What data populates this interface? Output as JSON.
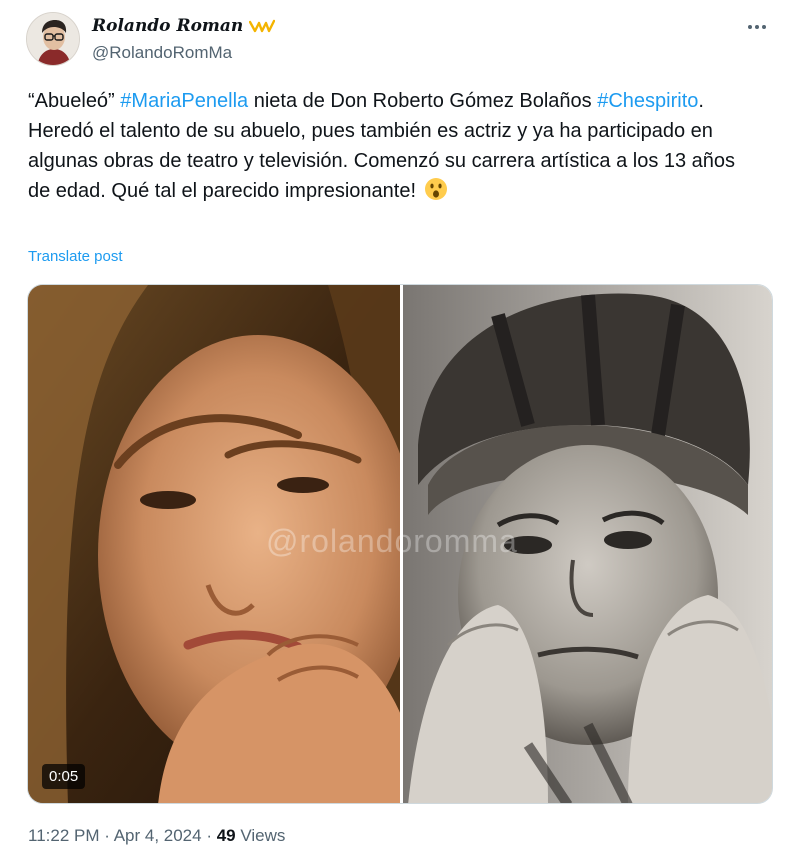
{
  "author": {
    "display_name": "Rolando Roman",
    "name_emoji": "crown-emoji",
    "handle": "@RolandoRomMa"
  },
  "menu": {
    "more_label": "···"
  },
  "tweet": {
    "text_parts": {
      "p1": "“Abueleó” ",
      "hashtag1": "#MariaPenella",
      "p2": " nieta de Don Roberto Gómez Bolaños ",
      "hashtag2": "#Chespirito",
      "p3": ". Heredó el talento de su abuelo, pues también es actriz y ya ha participado en algunas obras de teatro y televisión. Comenzó su carrera artística a los 13 años de edad. Qué tal el parecido impresionante! "
    },
    "emoji": "astonished-face-emoji",
    "translate_label": "Translate post"
  },
  "media": {
    "video_time": "0:05",
    "watermark": "@rolandoromma"
  },
  "meta": {
    "time": "11:22 PM",
    "sep1": " · ",
    "date": "Apr 4, 2024",
    "sep2": " · ",
    "views": "49",
    "views_label": " Views"
  },
  "colors": {
    "link": "#1d9bf0",
    "secondary_text": "#536471",
    "primary_text": "#0f1419"
  }
}
